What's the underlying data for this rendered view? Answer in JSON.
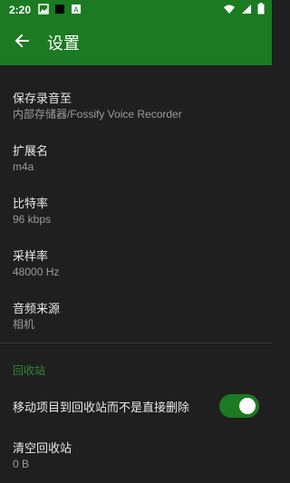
{
  "status_bar": {
    "time": "2:20",
    "icons": [
      "gallery-icon",
      "black-square-icon",
      "a-box-icon",
      "wifi-icon",
      "signal-icon",
      "battery-icon"
    ]
  },
  "app_bar": {
    "title": "设置",
    "back_icon": "arrow-left-icon"
  },
  "settings": [
    {
      "label": "保存录音至",
      "value": "内部存储器/Fossify Voice Recorder"
    },
    {
      "label": "扩展名",
      "value": "m4a"
    },
    {
      "label": "比特率",
      "value": "96 kbps"
    },
    {
      "label": "采样率",
      "value": "48000 Hz"
    },
    {
      "label": "音频来源",
      "value": "相机"
    }
  ],
  "recycle_bin": {
    "section_title": "回收站",
    "move_toggle_label": "移动项目到回收站而不是直接删除",
    "move_toggle_on": true,
    "empty_label": "清空回收站",
    "empty_value": "0 B"
  },
  "colors": {
    "primary": "#1b7a22",
    "background": "#1f1f1f",
    "section_title": "#2f8a35"
  }
}
